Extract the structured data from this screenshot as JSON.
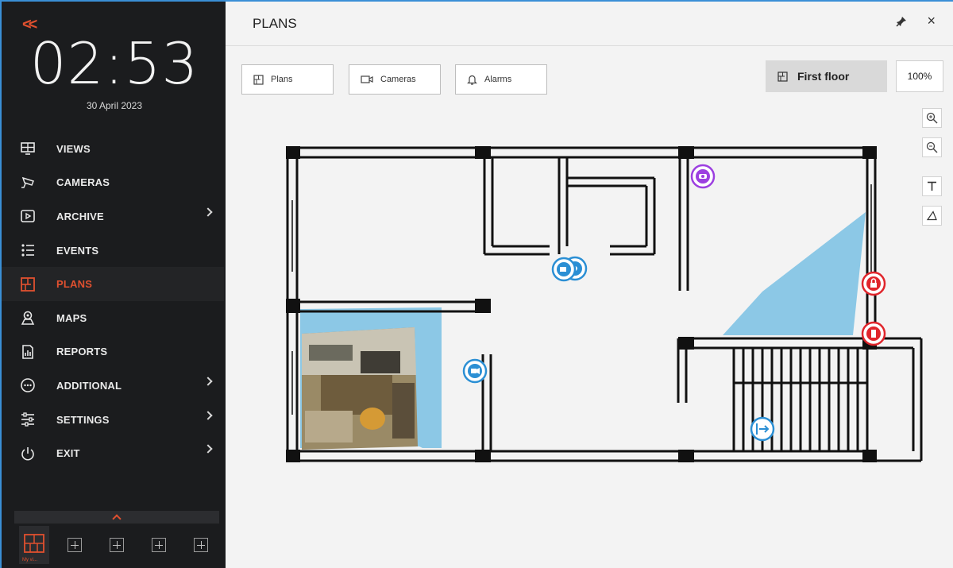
{
  "sidebar": {
    "clock": "02:53",
    "date": "30 April 2023",
    "items": [
      {
        "label": "VIEWS",
        "icon": "views-icon"
      },
      {
        "label": "CAMERAS",
        "icon": "camera-icon"
      },
      {
        "label": "ARCHIVE",
        "icon": "archive-icon"
      },
      {
        "label": "EVENTS",
        "icon": "events-icon"
      },
      {
        "label": "PLANS",
        "icon": "plans-icon"
      },
      {
        "label": "MAPS",
        "icon": "maps-icon"
      },
      {
        "label": "REPORTS",
        "icon": "reports-icon"
      },
      {
        "label": "ADDITIONAL",
        "icon": "more-icon"
      },
      {
        "label": "SETTINGS",
        "icon": "settings-icon"
      },
      {
        "label": "EXIT",
        "icon": "power-icon"
      }
    ],
    "current_layout_label": "My vi..."
  },
  "header": {
    "title": "PLANS"
  },
  "toolbar": {
    "plans_label": "Plans",
    "cameras_label": "Cameras",
    "alarms_label": "Alarms",
    "floor_label": "First floor",
    "zoom": "100%"
  },
  "colors": {
    "accent": "#e0502f",
    "sidebar_bg": "#1b1c1e",
    "device_blue": "#2b8fd4",
    "device_purple": "#9c3fe0",
    "device_red": "#e0252b",
    "fov_blue": "#8cc8e6"
  },
  "plan_devices": [
    {
      "name": "ptz-camera-icon",
      "color": "#9c3fe0"
    },
    {
      "name": "camera-icon",
      "color": "#2b8fd4"
    },
    {
      "name": "dome-camera-icon",
      "color": "#2b8fd4"
    },
    {
      "name": "camera-icon",
      "color": "#2b8fd4"
    },
    {
      "name": "lock-sensor-icon",
      "color": "#e0252b"
    },
    {
      "name": "door-sensor-icon",
      "color": "#e0252b"
    },
    {
      "name": "exit-icon",
      "color": "#2b8fd4"
    }
  ]
}
